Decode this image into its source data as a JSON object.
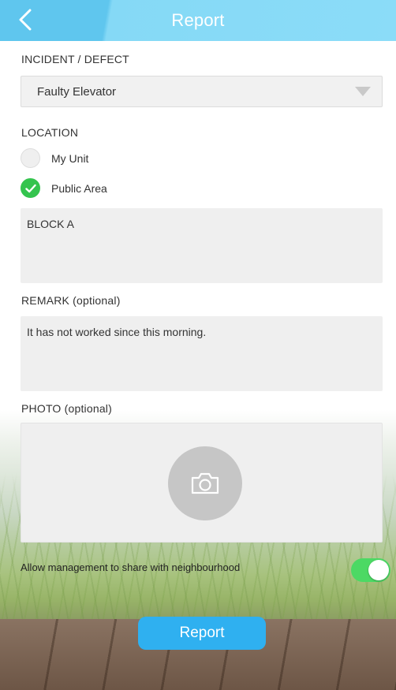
{
  "header": {
    "title": "Report",
    "back_icon": "chevron-left-icon"
  },
  "incident": {
    "label": "INCIDENT / DEFECT",
    "selected": "Faulty Elevator"
  },
  "location": {
    "label": "LOCATION",
    "options": [
      {
        "label": "My Unit",
        "checked": false
      },
      {
        "label": "Public Area",
        "checked": true
      }
    ],
    "value": "BLOCK A"
  },
  "remark": {
    "label": "REMARK (optional)",
    "value": "It has not worked since this morning."
  },
  "photo": {
    "label": "PHOTO (optional)",
    "icon": "camera-icon"
  },
  "share": {
    "label": "Allow management to share with neighbourhood",
    "enabled": true
  },
  "submit": {
    "label": "Report"
  },
  "colors": {
    "header": "#8bdcf8",
    "check_green": "#34c44e",
    "toggle_green": "#4cd964",
    "button_blue": "#2fb0f0"
  }
}
